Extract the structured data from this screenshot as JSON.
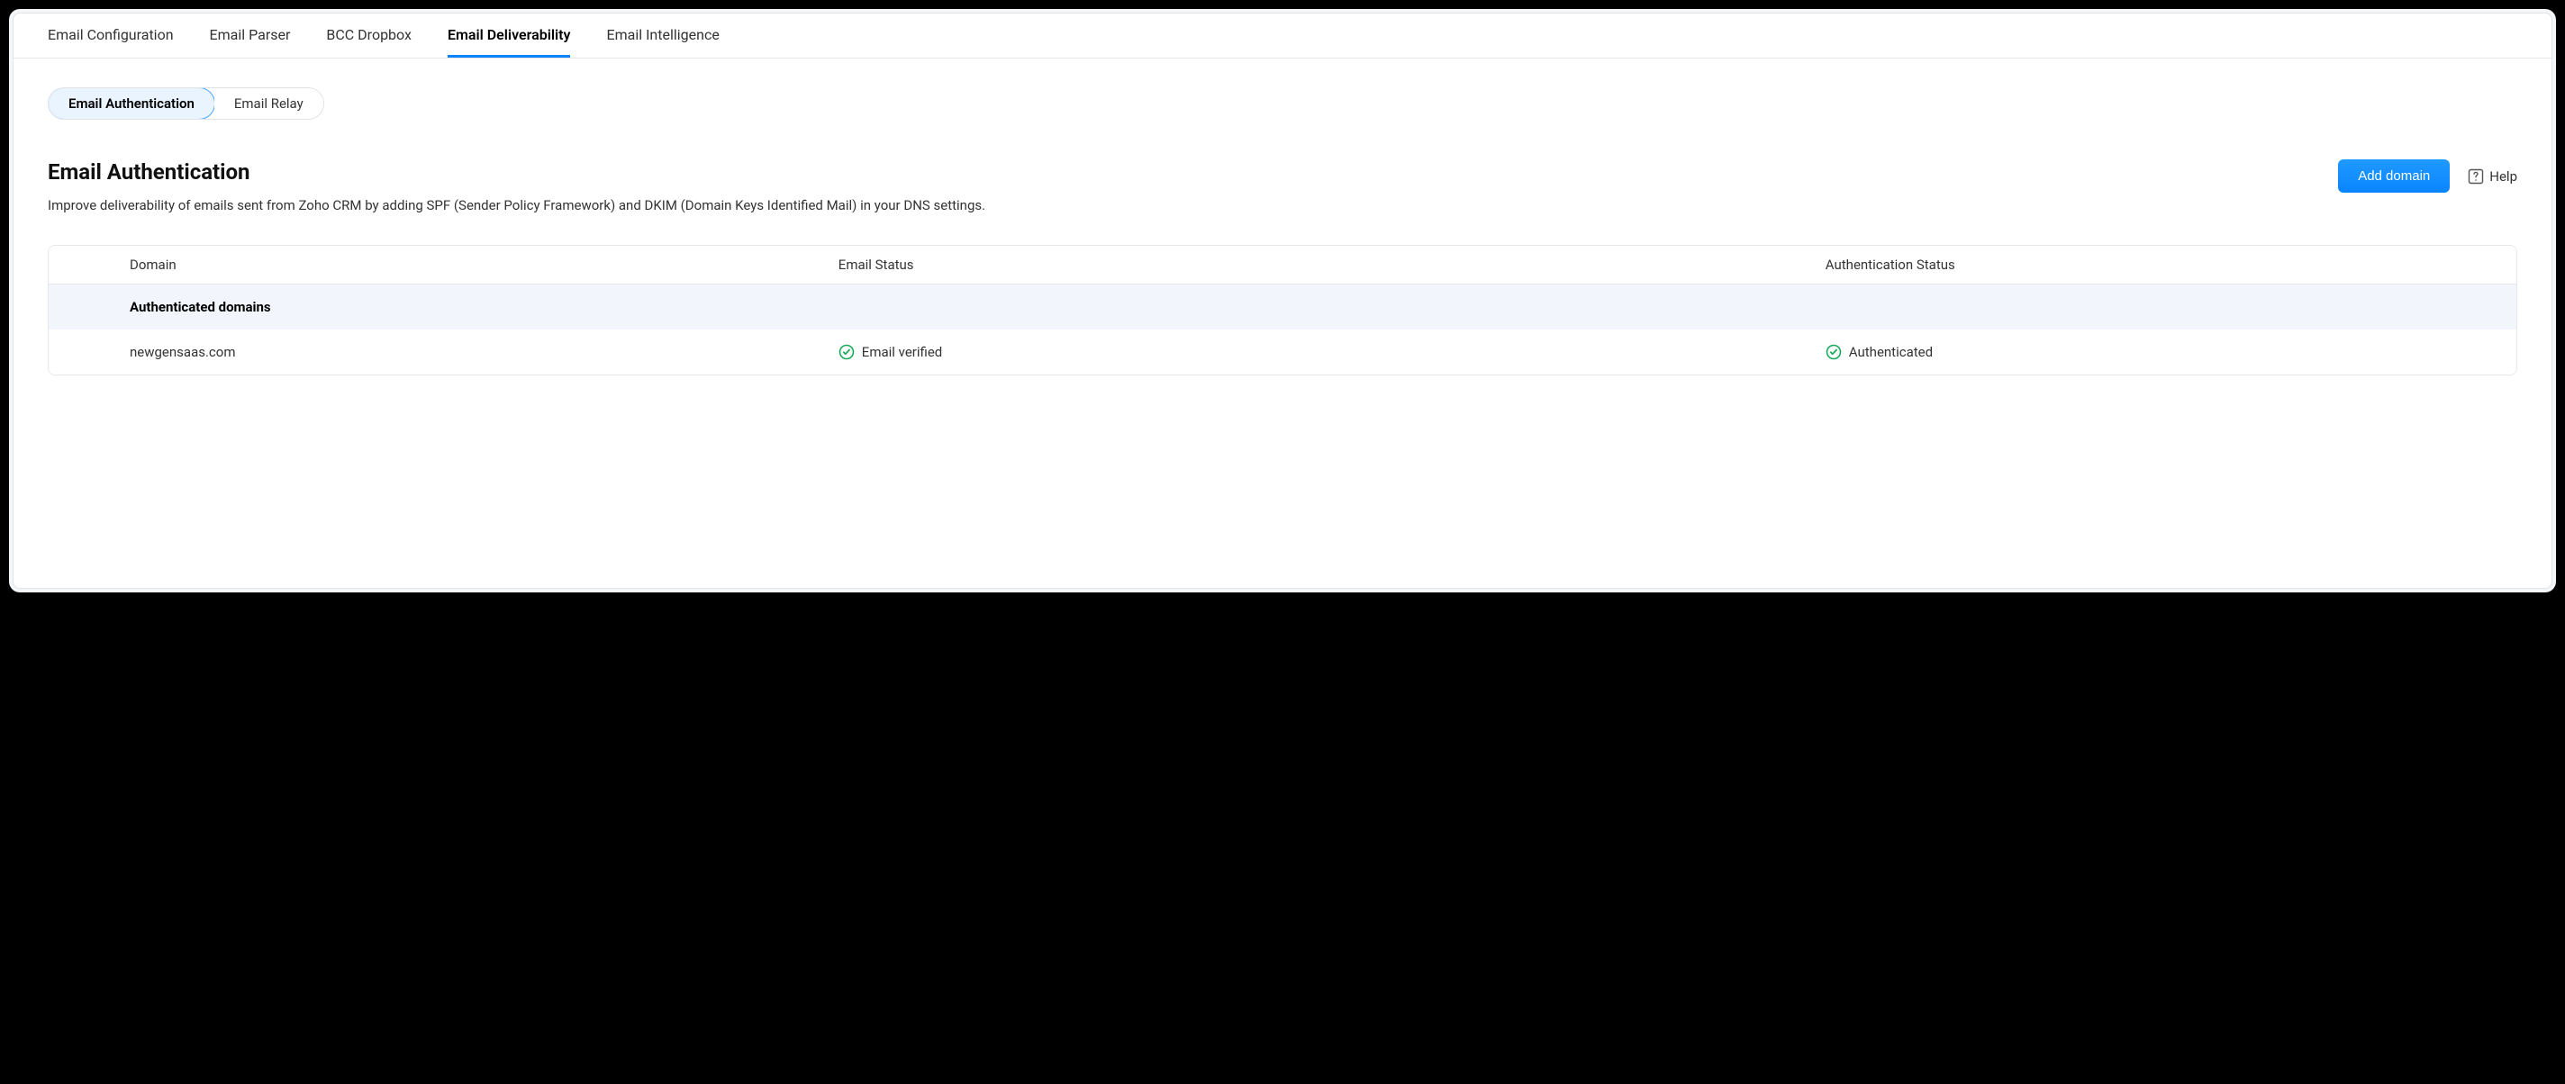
{
  "tabs": [
    {
      "label": "Email Configuration",
      "active": false
    },
    {
      "label": "Email Parser",
      "active": false
    },
    {
      "label": "BCC Dropbox",
      "active": false
    },
    {
      "label": "Email Deliverability",
      "active": true
    },
    {
      "label": "Email Intelligence",
      "active": false
    }
  ],
  "subTabs": [
    {
      "label": "Email Authentication",
      "active": true
    },
    {
      "label": "Email Relay",
      "active": false
    }
  ],
  "section": {
    "title": "Email Authentication",
    "description": "Improve deliverability of emails sent from Zoho CRM by adding SPF (Sender Policy Framework) and DKIM (Domain Keys Identified Mail) in your DNS settings."
  },
  "actions": {
    "addDomain": "Add domain",
    "help": "Help"
  },
  "table": {
    "headers": {
      "domain": "Domain",
      "emailStatus": "Email Status",
      "authStatus": "Authentication Status"
    },
    "groupHeader": "Authenticated domains",
    "rows": [
      {
        "domain": "newgensaas.com",
        "emailStatus": "Email verified",
        "authStatus": "Authenticated"
      }
    ]
  }
}
